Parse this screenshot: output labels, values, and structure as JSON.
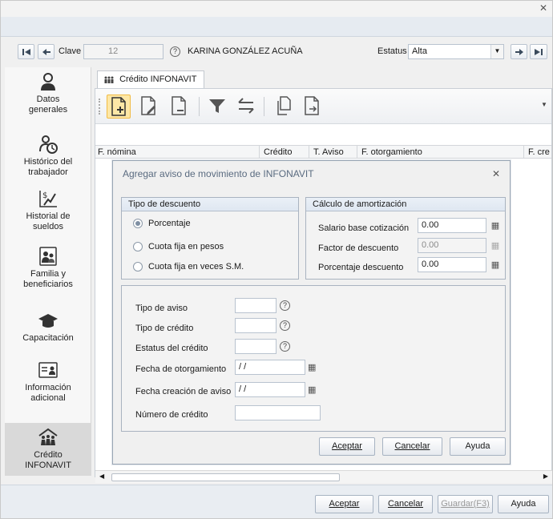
{
  "window": {
    "close_glyph": "✕"
  },
  "toolbar": {
    "clave_label": "Clave",
    "clave_value": "12",
    "employee_name": "KARINA GONZÁLEZ ACUÑA",
    "estatus_label": "Estatus",
    "estatus_value": "Alta"
  },
  "sidebar": {
    "items": [
      {
        "label": "Datos\ngenerales",
        "icon": "person-icon"
      },
      {
        "label": "Histórico del\ntrabajador",
        "icon": "history-icon"
      },
      {
        "label": "Historial de\nsueldos",
        "icon": "salary-history-icon"
      },
      {
        "label": "Familia y\nbeneficiarios",
        "icon": "family-icon"
      },
      {
        "label": "Capacitación",
        "icon": "graduation-cap-icon"
      },
      {
        "label": "Información\nadicional",
        "icon": "info-card-icon"
      },
      {
        "label": "Crédito\nINFONAVIT",
        "icon": "infonavit-icon"
      }
    ]
  },
  "tab": {
    "label": "Crédito INFONAVIT"
  },
  "grid": {
    "columns": [
      "F. nómina",
      "Crédito",
      "T. Aviso",
      "F. otorgamiento",
      "F. cre"
    ]
  },
  "dialog": {
    "title": "Agregar aviso de movimiento de INFONAVIT",
    "tipo_descuento": {
      "title": "Tipo de descuento",
      "options": [
        "Porcentaje",
        "Cuota fija en pesos",
        "Cuota fija en veces S.M."
      ],
      "selected": 0
    },
    "calculo": {
      "title": "Cálculo de amortización",
      "salario_label": "Salario base cotización",
      "salario_value": "0.00",
      "factor_label": "Factor de descuento",
      "factor_value": "0.00",
      "porcentaje_label": "Porcentaje descuento",
      "porcentaje_value": "0.00"
    },
    "form": {
      "tipo_aviso_label": "Tipo de aviso",
      "tipo_credito_label": "Tipo de crédito",
      "estatus_credito_label": "Estatus del crédito",
      "fecha_otorgamiento_label": "Fecha de otorgamiento",
      "fecha_otorgamiento_value": " / /",
      "fecha_creacion_label": "Fecha creación de aviso",
      "fecha_creacion_value": " / /",
      "numero_credito_label": "Número de crédito"
    },
    "buttons": {
      "aceptar": "Aceptar",
      "cancelar": "Cancelar",
      "ayuda": "Ayuda"
    }
  },
  "footer": {
    "aceptar": "Aceptar",
    "cancelar": "Cancelar",
    "guardar": "Guardar(F3)",
    "ayuda": "Ayuda"
  }
}
